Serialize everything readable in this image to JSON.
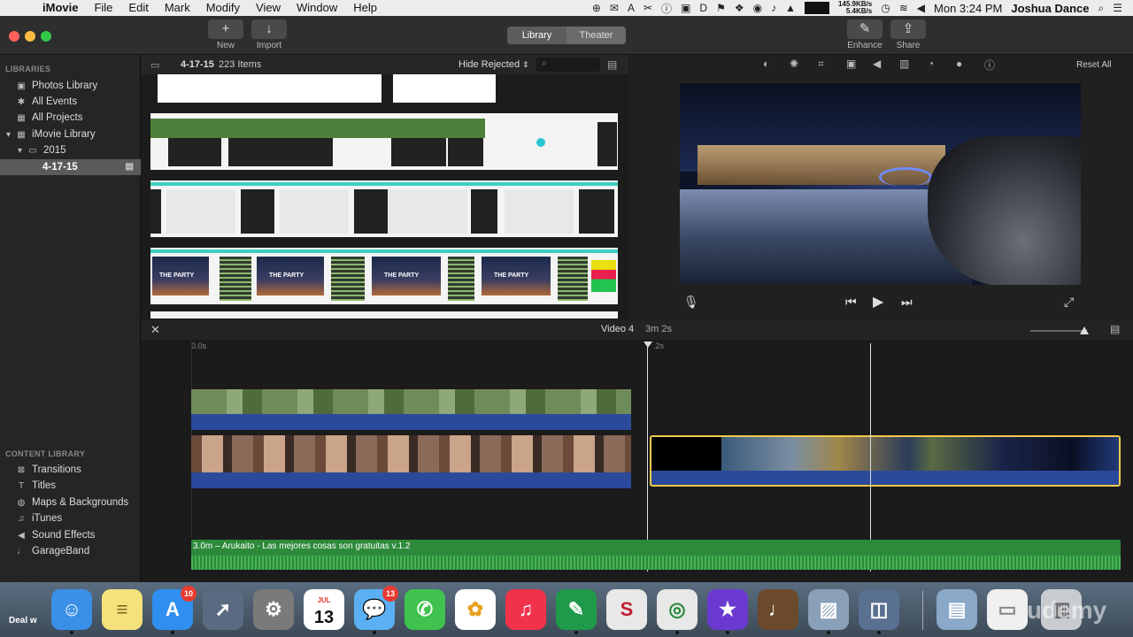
{
  "menubar": {
    "app_name": "iMovie",
    "menus": [
      "File",
      "Edit",
      "Mark",
      "Modify",
      "View",
      "Window",
      "Help"
    ],
    "net_up": "145.9KB/s",
    "net_down": "5.4KB/s",
    "clock": "Mon 3:24 PM",
    "user": "Joshua Dance"
  },
  "toolbar": {
    "new_label": "New",
    "import_label": "Import",
    "library_tab": "Library",
    "theater_tab": "Theater",
    "enhance_label": "Enhance",
    "share_label": "Share"
  },
  "sidebar": {
    "libraries_header": "LIBRARIES",
    "items": [
      {
        "label": "Photos Library",
        "icon": "photos-icon"
      },
      {
        "label": "All Events",
        "icon": "star-icon"
      },
      {
        "label": "All Projects",
        "icon": "grid-icon"
      },
      {
        "label": "iMovie Library",
        "icon": "grid-icon"
      },
      {
        "label": "2015",
        "icon": "folder-icon"
      },
      {
        "label": "4-17-15",
        "icon": "event-icon"
      }
    ],
    "content_header": "CONTENT LIBRARY",
    "content_items": [
      {
        "label": "Transitions",
        "icon": "transitions-icon"
      },
      {
        "label": "Titles",
        "icon": "titles-icon"
      },
      {
        "label": "Maps & Backgrounds",
        "icon": "globe-icon"
      },
      {
        "label": "iTunes",
        "icon": "music-note-icon"
      },
      {
        "label": "Sound Effects",
        "icon": "speaker-icon"
      },
      {
        "label": "GarageBand",
        "icon": "guitar-icon"
      }
    ]
  },
  "browser": {
    "event_name": "4-17-15",
    "item_count": "223 Items",
    "filter_label": "Hide Rejected",
    "thumb_text": "THE PARTY"
  },
  "viewer": {
    "reset_label": "Reset All"
  },
  "timeline": {
    "project_title": "Video 4",
    "duration": "3m 2s",
    "ruler_start": "0.0s",
    "ruler_mid": ".2s",
    "music_label": "3.0m – Arukaito - Las mejores cosas son gratuitas v.1.2"
  },
  "dock": {
    "appstore_badge": "10",
    "messages_badge": "13",
    "calendar_month": "JUL",
    "calendar_day": "13",
    "desktop_label": "Deal w",
    "watermark": "udemy"
  }
}
